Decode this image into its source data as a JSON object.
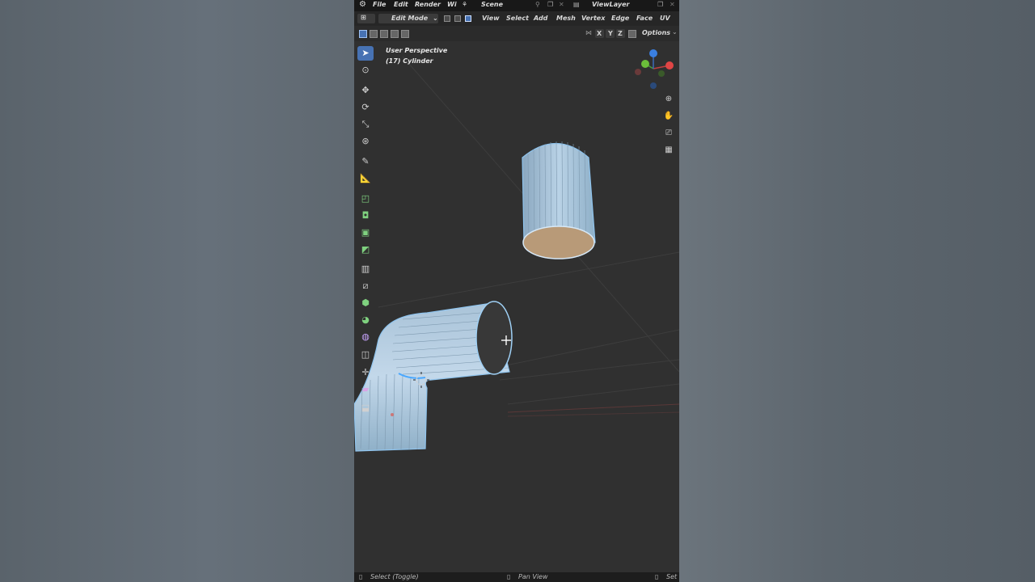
{
  "menu": {
    "file": "File",
    "edit": "Edit",
    "render": "Render",
    "window_short": "Wi",
    "scene": "Scene",
    "view_layer": "ViewLayer"
  },
  "header": {
    "mode": "Edit Mode",
    "view": "View",
    "select": "Select",
    "add": "Add",
    "mesh": "Mesh",
    "vertex": "Vertex",
    "edge": "Edge",
    "face": "Face",
    "uv": "UV"
  },
  "tool_header": {
    "axis_x": "X",
    "axis_y": "Y",
    "axis_z": "Z",
    "options": "Options"
  },
  "viewport": {
    "perspective": "User Perspective",
    "object": "(17) Cylinder"
  },
  "toolbar": {
    "icons": [
      "select-box-icon",
      "cursor-icon",
      "move-icon",
      "rotate-icon",
      "scale-icon",
      "transform-icon",
      "annotate-icon",
      "measure-icon",
      "add-cube-icon",
      "extrude-icon",
      "inset-icon",
      "bevel-icon",
      "loop-cut-icon",
      "knife-icon",
      "poly-build-icon",
      "spin-icon",
      "smooth-icon",
      "edge-slide-icon",
      "shrink-fatten-icon",
      "shear-icon",
      "rip-icon"
    ]
  },
  "status": {
    "left": "Select (Toggle)",
    "middle": "Pan View",
    "right": "Set"
  },
  "colors": {
    "accent": "#4772b3",
    "mesh_selected": "#7fb8e6",
    "face_selected": "#b89a78"
  }
}
